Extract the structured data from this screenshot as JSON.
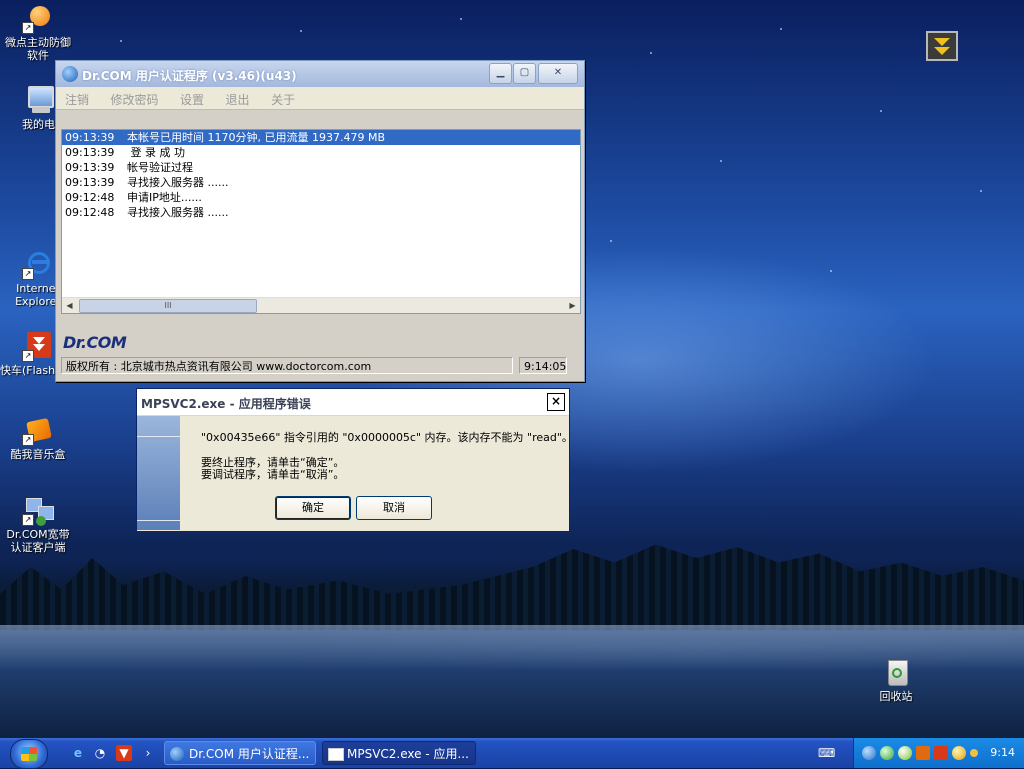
{
  "desktop": {
    "icons": [
      {
        "label": "微点主动防御软件"
      },
      {
        "label": "我的电脑"
      },
      {
        "label": "Internet Explorer"
      },
      {
        "label": "快车(Flash"
      },
      {
        "label": "酷我音乐盒"
      },
      {
        "label": "Dr.COM宽带认证客户端"
      },
      {
        "label": "回收站"
      }
    ]
  },
  "drcom_window": {
    "title": "Dr.COM 用户认证程序 (v3.46)(u43)",
    "menu": [
      "注销",
      "修改密码",
      "设置",
      "退出",
      "关于"
    ],
    "log": [
      {
        "time": "09:13:39",
        "text": "本帐号已用时间 1170分钟, 已用流量 1937.479 MB",
        "selected": true
      },
      {
        "time": "09:13:39",
        "text": " 登 录 成 功",
        "selected": false
      },
      {
        "time": "09:13:39",
        "text": "帐号验证过程",
        "selected": false
      },
      {
        "time": "09:13:39",
        "text": "寻找接入服务器 ......",
        "selected": false
      },
      {
        "time": "09:12:48",
        "text": "申请IP地址......",
        "selected": false
      },
      {
        "time": "09:12:48",
        "text": "寻找接入服务器 ......",
        "selected": false
      }
    ],
    "scroll_thumb_grip": "III",
    "brand": "Dr.COM",
    "status_copyright": "版权所有 : 北京城市热点资讯有限公司 www.doctorcom.com",
    "status_time": "9:14:05"
  },
  "error_dialog": {
    "title": "MPSVC2.exe - 应用程序错误",
    "close_label": "×",
    "message_line1": "\"0x00435e66\" 指令引用的 \"0x0000005c\" 内存。该内存不能为 \"read\"。",
    "message_line2": "要终止程序，请单击“确定”。",
    "message_line3": "要调试程序，请单击“取消”。",
    "ok_label": "确定",
    "cancel_label": "取消"
  },
  "taskbar": {
    "chevron": "›",
    "tasks": [
      {
        "label": "Dr.COM 用户认证程..."
      },
      {
        "label": "MPSVC2.exe - 应用..."
      }
    ],
    "clock": "9:14"
  },
  "colors": {
    "selection": "#316ac5",
    "taskbar": "#1f4bb5",
    "tray": "#0f6fcc"
  }
}
